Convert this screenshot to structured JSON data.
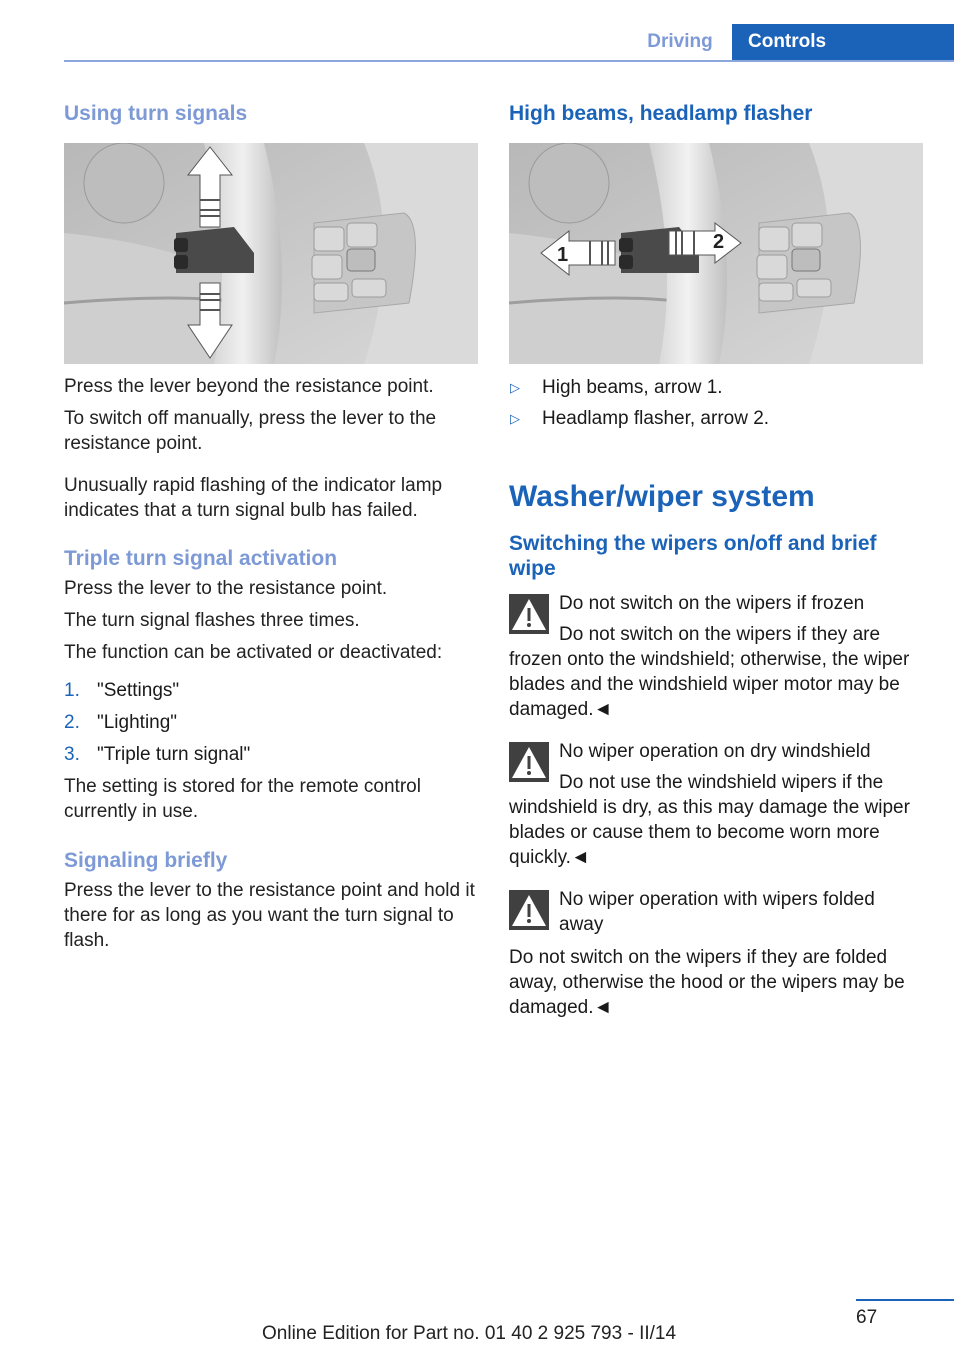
{
  "header": {
    "section_tab": "Driving",
    "chapter_tab": "Controls"
  },
  "left": {
    "using_turn_signals": {
      "heading": "Using turn signals",
      "figure_label": "turn-signal-lever-illustration",
      "p1": "Press the lever beyond the resistance point.",
      "p2": "To switch off manually, press the lever to the resistance point.",
      "p3": "Unusually rapid flashing of the indicator lamp indicates that a turn signal bulb has failed."
    },
    "triple": {
      "heading": "Triple turn signal activation",
      "p1": "Press the lever to the resistance point.",
      "p2": "The turn signal flashes three times.",
      "p3": "The function can be activated or deactivated:",
      "steps": [
        {
          "num": "1.",
          "text": "\"Settings\""
        },
        {
          "num": "2.",
          "text": "\"Lighting\""
        },
        {
          "num": "3.",
          "text": "\"Triple turn signal\""
        }
      ],
      "p4": "The setting is stored for the remote control currently in use."
    },
    "briefly": {
      "heading": "Signaling briefly",
      "p1": "Press the lever to the resistance point and hold it there for as long as you want the turn signal to flash."
    }
  },
  "right": {
    "high_beams": {
      "heading": "High beams, headlamp flasher",
      "arrow1_label": "1",
      "arrow2_label": "2",
      "bullets": [
        {
          "marker": "▷",
          "text": "High beams, arrow 1."
        },
        {
          "marker": "▷",
          "text": "Headlamp flasher, arrow 2."
        }
      ]
    },
    "washer": {
      "title": "Washer/wiper system",
      "subheading": "Switching the wipers on/off and brief wipe",
      "warnings": [
        {
          "icon": "warning-triangle-icon",
          "title": "Do not switch on the wipers if frozen",
          "body": "Do not switch on the wipers if they are frozen onto the windshield; otherwise, the wiper blades and the windshield wiper motor may be damaged.◄"
        },
        {
          "icon": "warning-triangle-icon",
          "title": "No wiper operation on dry windshield",
          "body": "Do not use the windshield wipers if the windshield is dry, as this may damage the wiper blades or cause them to become worn more quickly.◄"
        },
        {
          "icon": "warning-triangle-icon",
          "title": "No wiper operation with wipers folded away",
          "body": "Do not switch on the wipers if they are folded away, otherwise the hood or the wipers may be damaged.◄"
        }
      ]
    }
  },
  "footer": {
    "page_number": "67",
    "edition": "Online Edition for Part no. 01 40 2 925 793 - II/14"
  },
  "colors": {
    "primary_blue": "#1a63b8",
    "light_blue": "#7d9ad6",
    "warning_icon_bg": "#404040"
  }
}
